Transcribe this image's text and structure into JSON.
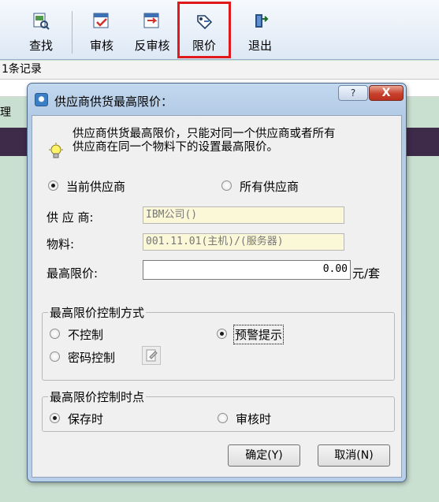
{
  "toolbar": {
    "buttons": [
      {
        "label": "查找",
        "icon": "search-doc-icon"
      },
      {
        "label": "审核",
        "icon": "audit-icon"
      },
      {
        "label": "反审核",
        "icon": "unaudit-icon"
      },
      {
        "label": "限价",
        "icon": "limit-price-icon",
        "highlight_color": "#e0191c"
      },
      {
        "label": "退出",
        "icon": "exit-door-icon"
      }
    ]
  },
  "records": {
    "count_text": "1条记录"
  },
  "background": {
    "cut_label": "理"
  },
  "dialog": {
    "title": "供应商供货最高限价：",
    "help_glyph": "?",
    "close_glyph": "X",
    "description_line1": "供应商供货最高限价，只能对同一个供应商或者所有",
    "description_line2": "供应商在同一个物料下的设置最高限价。",
    "scope": {
      "options": [
        {
          "label": "当前供应商",
          "checked": true
        },
        {
          "label": "所有供应商",
          "checked": false
        }
      ]
    },
    "fields": {
      "supplier_label": "供 应 商:",
      "supplier_value": "IBM公司()",
      "material_label": "物料:",
      "material_value": "001.11.01(主机)/(服务器)",
      "max_price_label": "最高限价:",
      "max_price_value": "0.00",
      "unit": "元/套"
    },
    "control_mode": {
      "legend": "最高限价控制方式",
      "options": [
        {
          "label": "不控制",
          "checked": false
        },
        {
          "label": "预警提示",
          "checked": true
        },
        {
          "label": "密码控制",
          "checked": false
        }
      ]
    },
    "control_timing": {
      "legend": "最高限价控制时点",
      "options": [
        {
          "label": "保存时",
          "checked": true
        },
        {
          "label": "审核时",
          "checked": false
        }
      ]
    },
    "buttons": {
      "ok": "确定(Y)",
      "cancel": "取消(N)"
    }
  },
  "colors": {
    "dialog_frame": "#b4cbe6",
    "close_button": "#c8412d",
    "readonly_field": "#fbf8d8",
    "background_band": "#3e2a49",
    "background": "#c9dfd0"
  }
}
